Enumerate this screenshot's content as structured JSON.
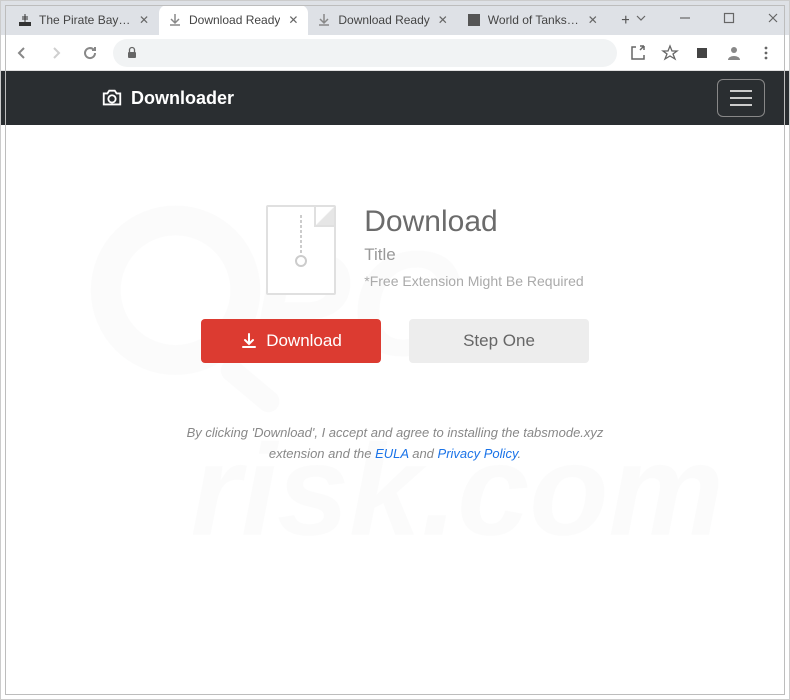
{
  "window": {
    "tabs": [
      {
        "title": "The Pirate Bay - Th",
        "active": false,
        "favicon": "ship"
      },
      {
        "title": "Download Ready",
        "active": true,
        "favicon": "download"
      },
      {
        "title": "Download Ready",
        "active": false,
        "favicon": "download"
      },
      {
        "title": "World of Tanks—F",
        "active": false,
        "favicon": "wot"
      }
    ]
  },
  "brand": {
    "name": "Downloader"
  },
  "main": {
    "heading": "Download",
    "title": "Title",
    "note": "*Free Extension Might Be Required"
  },
  "buttons": {
    "download": "Download",
    "step_one": "Step One"
  },
  "disclaimer": {
    "pre": "By clicking 'Download', I accept and agree to installing the tabsmode.xyz extension and the ",
    "eula": "EULA",
    "mid": " and ",
    "pp": "Privacy Policy",
    "post": "."
  },
  "watermark": {
    "text1": "PCrisk.com"
  }
}
